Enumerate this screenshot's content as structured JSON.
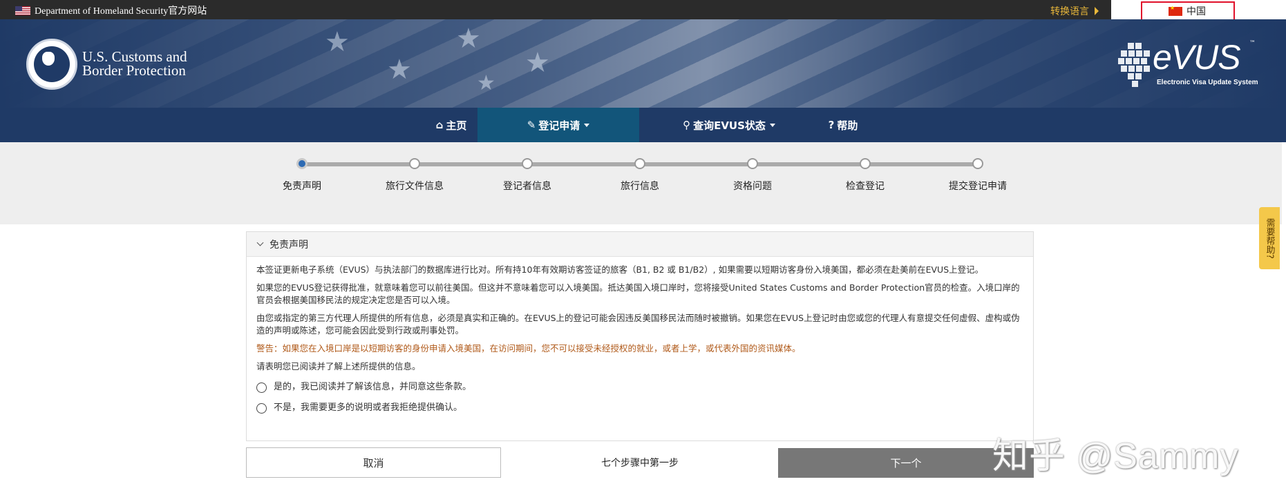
{
  "topbar": {
    "official_site": "Department of Homeland Security官方网站",
    "switch_language": "转换语言",
    "current_language": "中国"
  },
  "header": {
    "agency_line1": "U.S. Customs and",
    "agency_line2": "Border Protection",
    "evus_logo": "eVUS",
    "evus_tm": "™",
    "evus_subtitle": "Electronic Visa Update System"
  },
  "nav": {
    "items": [
      {
        "label": "主页",
        "icon": "home-icon"
      },
      {
        "label": "登记申请",
        "icon": "pencil-icon",
        "dropdown": true
      },
      {
        "label": "查询EVUS状态",
        "icon": "search-icon",
        "dropdown": true
      },
      {
        "label": "帮助",
        "icon": "question-circle-icon"
      }
    ]
  },
  "progress": {
    "steps": [
      "免责声明",
      "旅行文件信息",
      "登记者信息",
      "旅行信息",
      "资格问题",
      "检查登记",
      "提交登记申请"
    ],
    "current_index": 0
  },
  "panel": {
    "title": "免责声明",
    "paragraphs": [
      "本签证更新电子系统（EVUS）与执法部门的数据库进行比对。所有持10年有效期访客签证的旅客（B1, B2 或 B1/B2）, 如果需要以短期访客身份入境美国，都必须在赴美前在EVUS上登记。",
      "如果您的EVUS登记获得批准，就意味着您可以前往美国。但这并不意味着您可以入境美国。抵达美国入境口岸时，您将接受United States Customs and Border Protection官员的检查。入境口岸的官员会根据美国移民法的规定决定您是否可以入境。",
      "由您或指定的第三方代理人所提供的所有信息，必须是真实和正确的。在EVUS上的登记可能会因违反美国移民法而随时被撤销。如果您在EVUS上登记时由您或您的代理人有意提交任何虚假、虚构或伪造的声明或陈述，您可能会因此受到行政或刑事处罚。"
    ],
    "warning": "警告：如果您在入境口岸是以短期访客的身份申请入境美国，在访问期间，您不可以接受未经授权的就业，或者上学，或代表外国的资讯媒体。",
    "confirm_prompt": "请表明您已阅读并了解上述所提供的信息。",
    "option_yes": "是的，我已阅读并了解该信息，并同意这些条款。",
    "option_no": "不是，我需要更多的说明或者我拒绝提供确认。"
  },
  "footer": {
    "cancel_label": "取消",
    "step_counter": "七个步骤中第一步",
    "next_label": "下一个"
  },
  "help_tab": "需要帮助?",
  "watermark": "知乎 @Sammy",
  "colors": {
    "nav_bg": "#1f3a66",
    "nav_active": "#12557a",
    "current_step": "#2d6ab3",
    "warning_text": "#b05a1a",
    "next_button": "#777777",
    "help_tab": "#f4c84a"
  }
}
